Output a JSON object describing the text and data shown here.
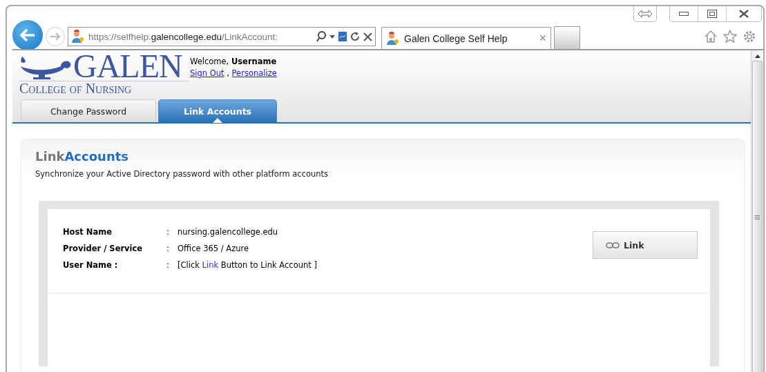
{
  "browser": {
    "address": "https://selfhelp.**galencollege.edu**/LinkAccount:",
    "tab_title": "Galen College Self Help",
    "tab_close": "×"
  },
  "header": {
    "logo_main": "GALEN",
    "logo_sub": "College of Nursing",
    "welcome": "Welcome,",
    "username": "Username",
    "sign_out": "Sign Out",
    "separator": ",",
    "personalize": "Personalize"
  },
  "tabs": [
    {
      "label": "Change Password",
      "selected": false
    },
    {
      "label": "Link Accounts",
      "selected": true
    }
  ],
  "page": {
    "heading_parts": [
      "Link",
      "Accounts"
    ],
    "description": "Synchronize your Active Directory password with other platform accounts"
  },
  "fields": [
    {
      "label": "Host Name",
      "colon": ":",
      "value": "nursing.galencollege.edu",
      "kind": "text"
    },
    {
      "label": "Provider / Service",
      "colon": ":",
      "value": "Office 365 / Azure",
      "kind": "text"
    },
    {
      "label": "User Name :",
      "colon": ":",
      "value_parts": [
        "[Click ",
        "Link",
        " Button to Link Account ]"
      ],
      "kind": "hint"
    }
  ],
  "link_button": "Link"
}
